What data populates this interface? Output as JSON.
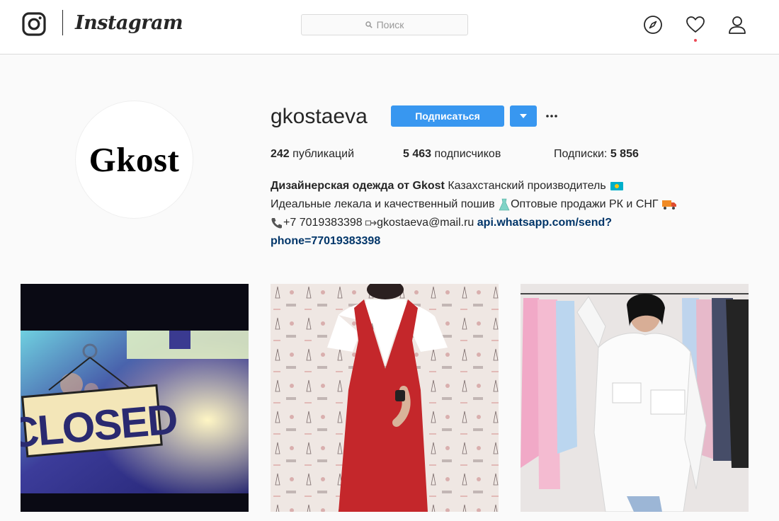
{
  "nav": {
    "wordmark": "Instagram",
    "search_placeholder": "Поиск",
    "icons": [
      "instagram-glyph-icon",
      "search-icon",
      "explore-compass-icon",
      "activity-heart-icon",
      "profile-person-icon"
    ],
    "notification_dot_color": "#ed4956"
  },
  "profile": {
    "avatar_text": "Gkost",
    "username": "gkostaeva",
    "follow_label": "Подписаться",
    "more_label": "···",
    "accent_color": "#3897f0",
    "stats": {
      "posts_count": "242",
      "posts_label": "публикаций",
      "followers_count": "5 463",
      "followers_label": "подписчиков",
      "following_label": "Подписки:",
      "following_count": "5 856"
    },
    "bio": {
      "name": "Дизайнерская одежда от Gkost",
      "line1_rest": "Казахстанский производитель",
      "line2": "Идеальные лекала и качественный пошив",
      "line2_rest": "Оптовые продажи РК и СНГ",
      "phone": "+7 7019383398",
      "email": "gkostaeva@mail.ru",
      "link_part1": "api.whatsapp.com/send?",
      "link_part2": "phone=77019383398",
      "link_color": "#003569"
    }
  },
  "posts": [
    {
      "alt": "CLOSED",
      "sign_text": "CLOSED"
    },
    {
      "alt": "red sleeveless dress over white tee"
    },
    {
      "alt": "white oversized shirt"
    }
  ]
}
